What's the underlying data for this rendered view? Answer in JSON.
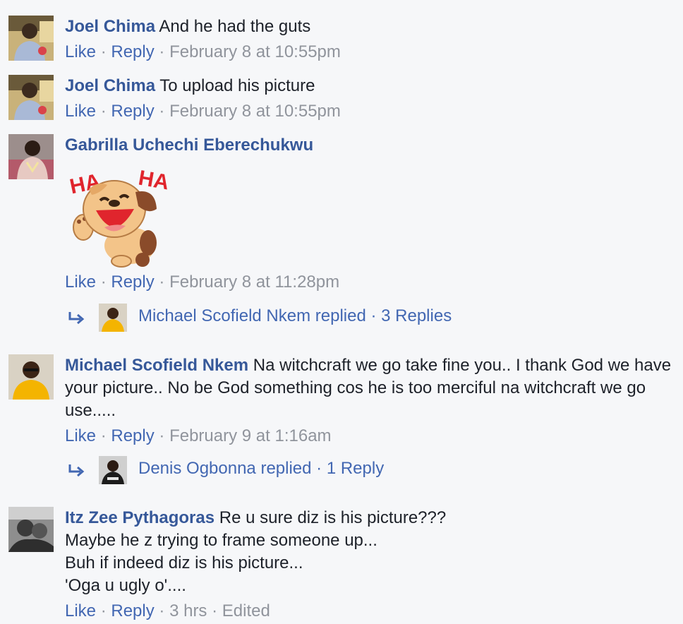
{
  "comments": [
    {
      "author": "Joel Chima",
      "lines": [
        "And he had the guts"
      ],
      "like": "Like",
      "reply": "Reply",
      "time": "February 8 at 10:55pm"
    },
    {
      "author": "Joel Chima",
      "lines": [
        "To upload his picture"
      ],
      "like": "Like",
      "reply": "Reply",
      "time": "February 8 at 10:55pm"
    },
    {
      "author": "Gabrilla Uchechi Eberechukwu",
      "lines": [],
      "sticker": "laughing-dog-sticker",
      "sticker_text": [
        "HA",
        "HA"
      ],
      "like": "Like",
      "reply": "Reply",
      "time": "February 8 at 11:28pm",
      "replies": "Michael Scofield Nkem replied · 3 Replies"
    },
    {
      "author": "Michael Scofield Nkem",
      "lines": [
        "Na witchcraft we go take fine you.. I thank God we have",
        "your picture.. No be God something cos he is too merciful na witchcraft we go",
        "use....."
      ],
      "like": "Like",
      "reply": "Reply",
      "time": "February 9 at 1:16am",
      "replies": "Denis Ogbonna replied · 1 Reply"
    },
    {
      "author": "Itz Zee Pythagoras",
      "lines": [
        "Re u sure diz is his picture???",
        "Maybe he z trying to frame someone up...",
        "Buh if indeed diz is his picture...",
        "'Oga u ugly o'...."
      ],
      "like": "Like",
      "reply": "Reply",
      "time": "3 hrs",
      "edited": "Edited"
    }
  ],
  "separator": "·",
  "colors": {
    "author": "#365899",
    "link": "#4267b2",
    "meta": "#90949c",
    "text": "#1d2129",
    "background": "#f6f7f9"
  }
}
